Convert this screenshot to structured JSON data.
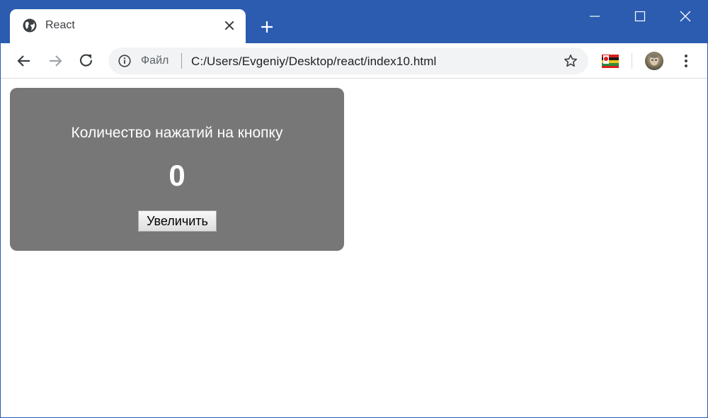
{
  "browser": {
    "tab": {
      "title": "React",
      "favicon": "globe-icon"
    },
    "address_bar": {
      "scheme_label": "Файл",
      "url": "C:/Users/Evgeniy/Desktop/react/index10.html"
    },
    "accent_color": "#2b5cb0"
  },
  "page": {
    "heading": "Количество нажатий на кнопку",
    "count": "0",
    "button_label": "Увеличить",
    "card_color": "#777777"
  }
}
